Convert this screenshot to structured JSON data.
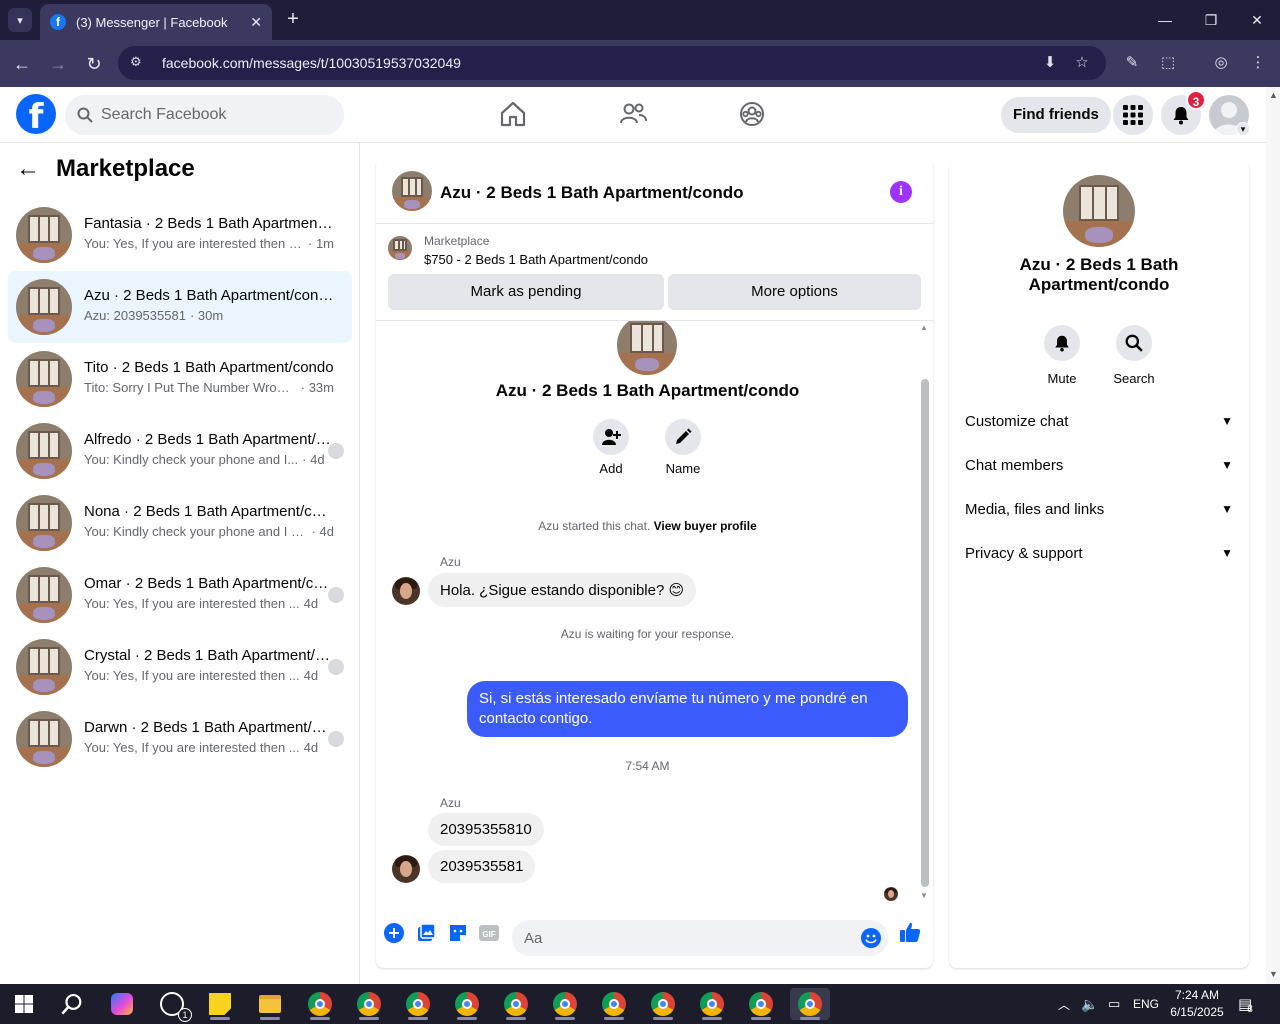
{
  "browser": {
    "tab_title": "(3) Messenger | Facebook",
    "url": "facebook.com/messages/t/10030519537032049"
  },
  "fb_header": {
    "search_placeholder": "Search Facebook",
    "find_friends": "Find friends",
    "notification_count": "3"
  },
  "sidebar": {
    "title": "Marketplace",
    "conversations": [
      {
        "name": "Fantasia · 2 Beds 1 Bath Apartment/condo",
        "preview": "You: Yes, If you are interested then send me your number",
        "time": "· 1m",
        "active": false
      },
      {
        "name": "Azu · 2 Beds 1 Bath Apartment/condo",
        "preview": "Azu: 2039535581",
        "time": "· 30m",
        "active": true
      },
      {
        "name": "Tito · 2 Beds 1 Bath Apartment/condo",
        "preview": "Tito: Sorry I Put The Number Wrong...",
        "time": "· 33m",
        "active": false
      },
      {
        "name": "Alfredo · 2 Beds 1 Bath Apartment/condo",
        "preview": "You: Kindly check your phone and I...",
        "time": "· 4d",
        "active": false
      },
      {
        "name": "Nona · 2 Beds 1 Bath Apartment/condo",
        "preview": "You: Kindly check your phone and I wi...",
        "time": "· 4d",
        "active": false
      },
      {
        "name": "Omar · 2 Beds 1 Bath Apartment/condo",
        "preview": "You: Yes, If you are interested then ...",
        "time": "4d",
        "active": false
      },
      {
        "name": "Crystal · 2 Beds 1 Bath Apartment/condo",
        "preview": "You: Yes, If you are interested then ...",
        "time": "4d",
        "active": false
      },
      {
        "name": "Darwn · 2 Beds 1 Bath Apartment/condo",
        "preview": "You: Yes, If you are interested then ...",
        "time": "4d",
        "active": false
      }
    ]
  },
  "chat": {
    "title": "Azu · 2 Beds 1 Bath Apartment/condo",
    "listing_label": "Marketplace",
    "listing_price": "$750 - 2 Beds 1 Bath Apartment/condo",
    "mark_pending": "Mark as pending",
    "more_options": "More options",
    "intro_name": "Azu · 2 Beds 1 Bath Apartment/condo",
    "add_label": "Add",
    "name_label": "Name",
    "started_text": "Azu started this chat.",
    "view_buyer": "View buyer profile",
    "sender_1": "Azu",
    "msg_1": "Hola. ¿Sigue estando disponible? 😊",
    "waiting_text": "Azu is waiting for your response.",
    "msg_out": "Si, si estás interesado envíame tu número y me pondré en contacto contigo.",
    "timestamp": "7:54 AM",
    "sender_2": "Azu",
    "msg_2": "20395355810",
    "msg_3": "2039535581",
    "composer_placeholder": "Aa"
  },
  "right_panel": {
    "name": "Azu · 2 Beds 1 Bath Apartment/condo",
    "mute": "Mute",
    "search": "Search",
    "sections": [
      "Customize chat",
      "Chat members",
      "Media, files and links",
      "Privacy & support"
    ]
  },
  "taskbar": {
    "whatsapp_badge": "1",
    "lang": "ENG",
    "time": "7:24 AM",
    "date": "6/15/2025",
    "notif_count": "8"
  },
  "colors": {
    "fb_blue": "#0866ff",
    "outgoing_bubble": "#3b5bfd",
    "active_row": "#ebf5ff",
    "info_purple": "#a033ff"
  }
}
